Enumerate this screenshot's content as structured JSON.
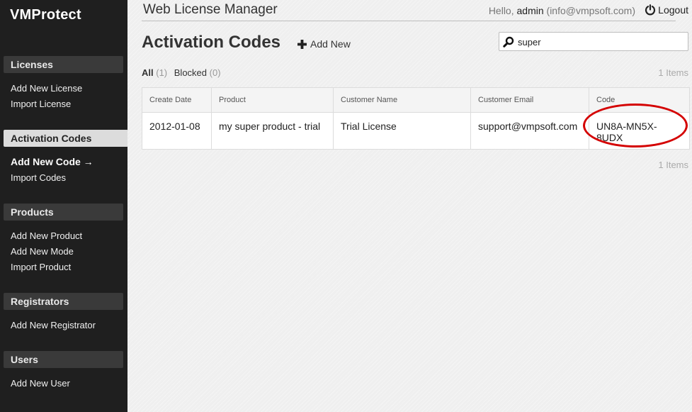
{
  "sidebar": {
    "brand": "VMProtect",
    "sections": [
      {
        "header": "Licenses",
        "links": [
          "Add New License",
          "Import License"
        ]
      },
      {
        "header": "Activation Codes",
        "links": [
          "Add New Code →",
          "Import Codes"
        ]
      },
      {
        "header": "Products",
        "links": [
          "Add New Product",
          "Add New Mode",
          "Import Product"
        ]
      },
      {
        "header": "Registrators",
        "links": [
          "Add New Registrator"
        ]
      },
      {
        "header": "Users",
        "links": [
          "Add New User"
        ]
      }
    ]
  },
  "header": {
    "app_title": "Web License Manager",
    "greeting_prefix": "Hello,",
    "username": "admin",
    "email": "(info@vmpsoft.com)",
    "logout_label": "Logout"
  },
  "page": {
    "title": "Activation Codes",
    "add_new_label": "Add New",
    "search_value": "super",
    "filters": [
      {
        "label": "All",
        "count": "(1)"
      },
      {
        "label": "Blocked",
        "count": "(0)"
      }
    ],
    "items_top": "1 Items",
    "items_bottom": "1 Items"
  },
  "table": {
    "columns": [
      "Create Date",
      "Product",
      "Customer Name",
      "Customer Email",
      "Code"
    ],
    "rows": [
      [
        "2012-01-08",
        "my super product - trial",
        "Trial License",
        "support@vmpsoft.com",
        "UN8A-MN5X-8UDX"
      ]
    ]
  },
  "colors": {
    "sidebar_bg": "#1f1f1f",
    "highlight": "#d40000"
  }
}
